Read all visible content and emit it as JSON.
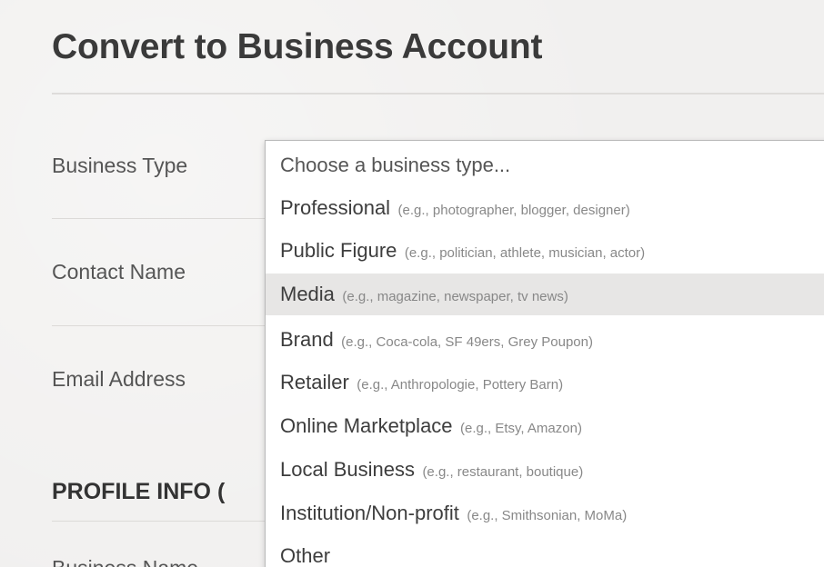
{
  "header": {
    "title": "Convert to Business Account"
  },
  "form": {
    "labels": {
      "business_type": "Business Type",
      "contact_name": "Contact Name",
      "email_address": "Email Address",
      "business_name_partial": "Business Name"
    },
    "section_heading": "PROFILE INFO",
    "section_heading_tail": "("
  },
  "dropdown": {
    "placeholder": "Choose a business type...",
    "options": [
      {
        "name": "Professional",
        "example": "(e.g., photographer, blogger, designer)"
      },
      {
        "name": "Public Figure",
        "example": "(e.g., politician, athlete, musician, actor)"
      },
      {
        "name": "Media",
        "example": "(e.g., magazine, newspaper, tv news)"
      },
      {
        "name": "Brand",
        "example": "(e.g., Coca-cola, SF 49ers, Grey Poupon)"
      },
      {
        "name": "Retailer",
        "example": "(e.g., Anthropologie, Pottery Barn)"
      },
      {
        "name": "Online Marketplace",
        "example": "(e.g., Etsy, Amazon)"
      },
      {
        "name": "Local Business",
        "example": "(e.g., restaurant, boutique)"
      },
      {
        "name": "Institution/Non-profit",
        "example": "(e.g., Smithsonian, MoMa)"
      },
      {
        "name": "Other",
        "example": ""
      }
    ],
    "highlighted_option": "Media"
  }
}
